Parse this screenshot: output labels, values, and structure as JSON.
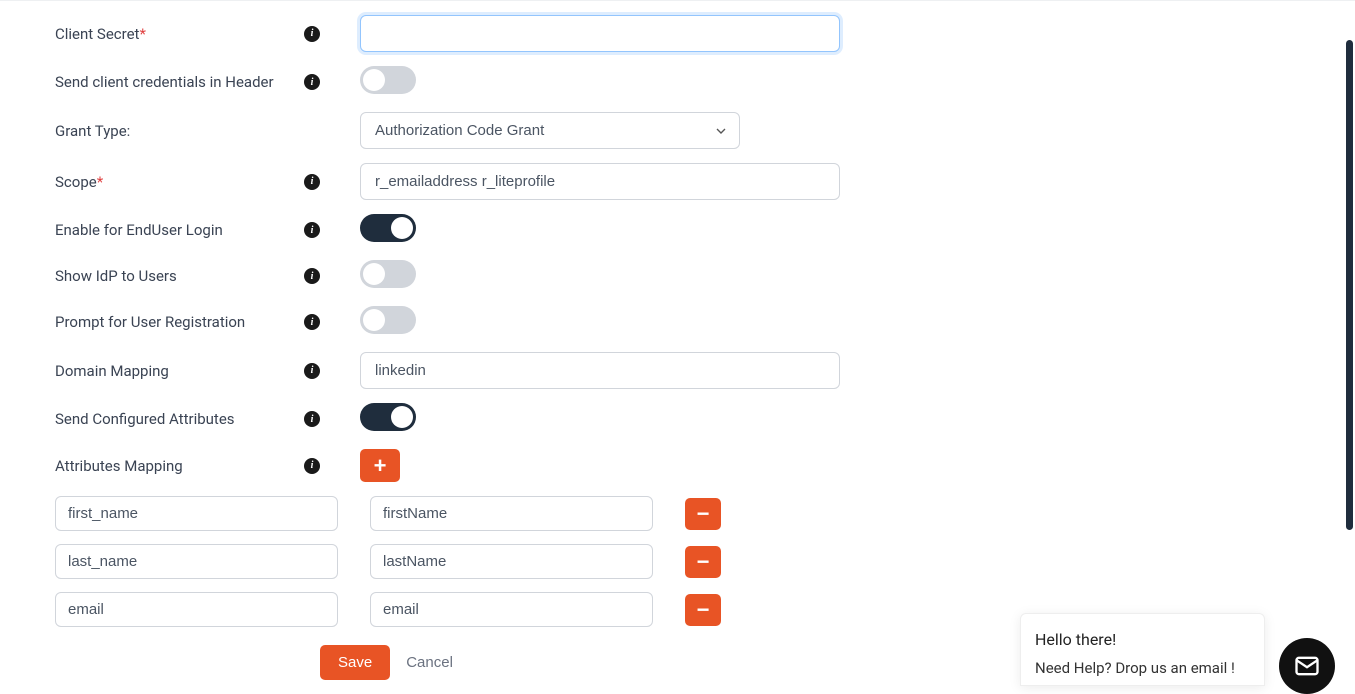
{
  "fields": {
    "client_secret": {
      "label": "Client Secret",
      "value": ""
    },
    "send_header": {
      "label": "Send client credentials in Header",
      "on": false
    },
    "grant_type": {
      "label": "Grant Type:",
      "value": "Authorization Code Grant"
    },
    "scope": {
      "label": "Scope",
      "value": "r_emailaddress r_liteprofile"
    },
    "enable_enduser": {
      "label": "Enable for EndUser Login",
      "on": true
    },
    "show_idp": {
      "label": "Show IdP to Users",
      "on": false
    },
    "prompt_reg": {
      "label": "Prompt for User Registration",
      "on": false
    },
    "domain_mapping": {
      "label": "Domain Mapping",
      "value": "linkedin"
    },
    "send_attrs": {
      "label": "Send Configured Attributes",
      "on": true
    },
    "attrs_mapping": {
      "label": "Attributes Mapping"
    }
  },
  "mappings": [
    {
      "left": "first_name",
      "right": "firstName"
    },
    {
      "left": "last_name",
      "right": "lastName"
    },
    {
      "left": "email",
      "right": "email"
    }
  ],
  "buttons": {
    "save": "Save",
    "cancel": "Cancel"
  },
  "chat": {
    "greeting": "Hello there!",
    "subtext": "Need Help? Drop us an email !"
  }
}
